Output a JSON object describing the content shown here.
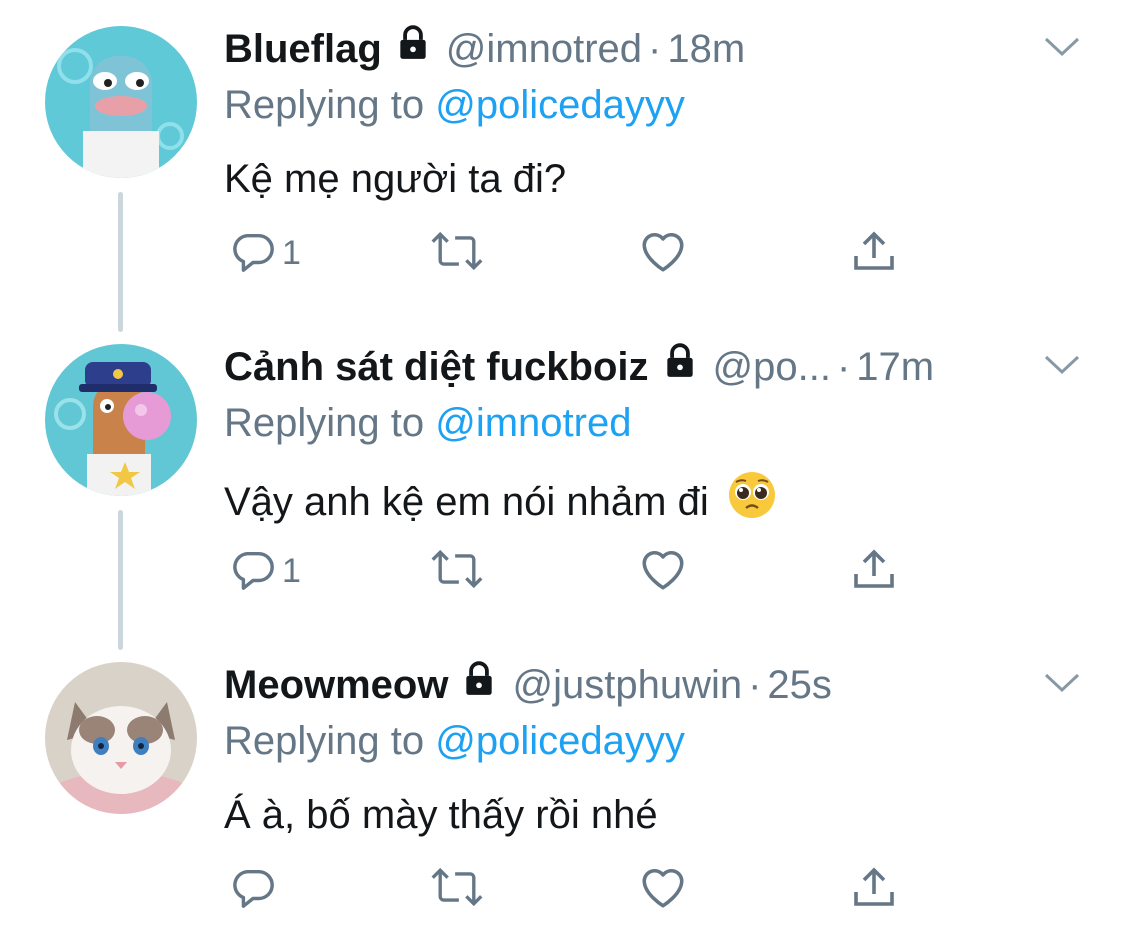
{
  "tweets": [
    {
      "name": "Blueflag",
      "handle": "@imnotred",
      "separator": "·",
      "time": "18m",
      "replying_prefix": "Replying to ",
      "replying_to": "@policedayyy",
      "text": "Kệ mẹ người ta đi?",
      "reply_count": "1"
    },
    {
      "name": "Cảnh sát diệt fuckboiz",
      "handle": "@po...",
      "separator": "·",
      "time": "17m",
      "replying_prefix": "Replying to ",
      "replying_to": "@imnotred",
      "text": "Vậy anh kệ em nói nhảm đi",
      "reply_count": "1",
      "emoji": "pleading-face-emoji"
    },
    {
      "name": "Meowmeow",
      "handle": "@justphuwin",
      "separator": "·",
      "time": "25s",
      "replying_prefix": "Replying to ",
      "replying_to": "@policedayyy",
      "text": "Á à, bố mày thấy rồi nhé",
      "reply_count": ""
    }
  ],
  "colors": {
    "text": "#14171a",
    "secondary": "#657786",
    "link": "#1da1f2",
    "thread_line": "#ccd6dd"
  },
  "icons": [
    "lock-icon",
    "chevron-down-icon",
    "reply-icon",
    "retweet-icon",
    "like-icon",
    "share-icon"
  ]
}
